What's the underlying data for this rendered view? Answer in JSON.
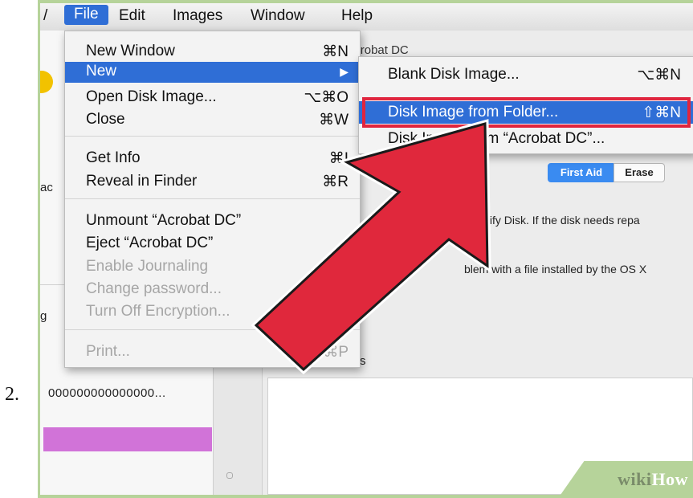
{
  "step": "2.",
  "menubar": {
    "items": [
      "File",
      "Edit",
      "Images",
      "Window",
      "Help"
    ],
    "active": "File"
  },
  "window": {
    "title": "Acrobat DC",
    "left_texts": [
      "ac",
      "g"
    ],
    "device_id": "000000000000000...",
    "tabs": {
      "first_aid": "First Aid",
      "erase": "Erase"
    },
    "info_line1": "k Verify Disk. If the disk needs repa",
    "info_line2": "blem with a file installed by the OS X",
    "small_s": "s"
  },
  "file_menu": {
    "new_window": {
      "label": "New Window",
      "shortcut": "⌘N"
    },
    "new": {
      "label": "New",
      "shortcut": "▶"
    },
    "open_disk_image": {
      "label": "Open Disk Image...",
      "shortcut": "⌥⌘O"
    },
    "close": {
      "label": "Close",
      "shortcut": "⌘W"
    },
    "get_info": {
      "label": "Get Info",
      "shortcut": "⌘I"
    },
    "reveal_in_finder": {
      "label": "Reveal in Finder",
      "shortcut": "⌘R"
    },
    "unmount": {
      "label": "Unmount “Acrobat DC”",
      "shortcut": ""
    },
    "eject": {
      "label": "Eject “Acrobat DC”",
      "shortcut": ""
    },
    "enable_journaling": {
      "label": "Enable Journaling",
      "shortcut": ""
    },
    "change_password": {
      "label": "Change password...",
      "shortcut": ""
    },
    "turn_off_encryption": {
      "label": "Turn Off Encryption...",
      "shortcut": ""
    },
    "print": {
      "label": "Print...",
      "shortcut": "⌘P"
    }
  },
  "new_submenu": {
    "blank_disk_image": {
      "label": "Blank Disk Image...",
      "shortcut": "⌥⌘N"
    },
    "disk_image_from_folder": {
      "label": "Disk Image from Folder...",
      "shortcut": "⇧⌘N"
    },
    "disk_image_from_acrobat": {
      "label": "Disk Image from “Acrobat DC”...",
      "shortcut": ""
    }
  },
  "watermark": {
    "wiki": "wiki",
    "how": "How"
  },
  "colors": {
    "menu_highlight": "#2f6ed6",
    "red_callout": "#e0253e",
    "frame_green": "#b6d39a",
    "volume_purple": "#d173d8"
  }
}
